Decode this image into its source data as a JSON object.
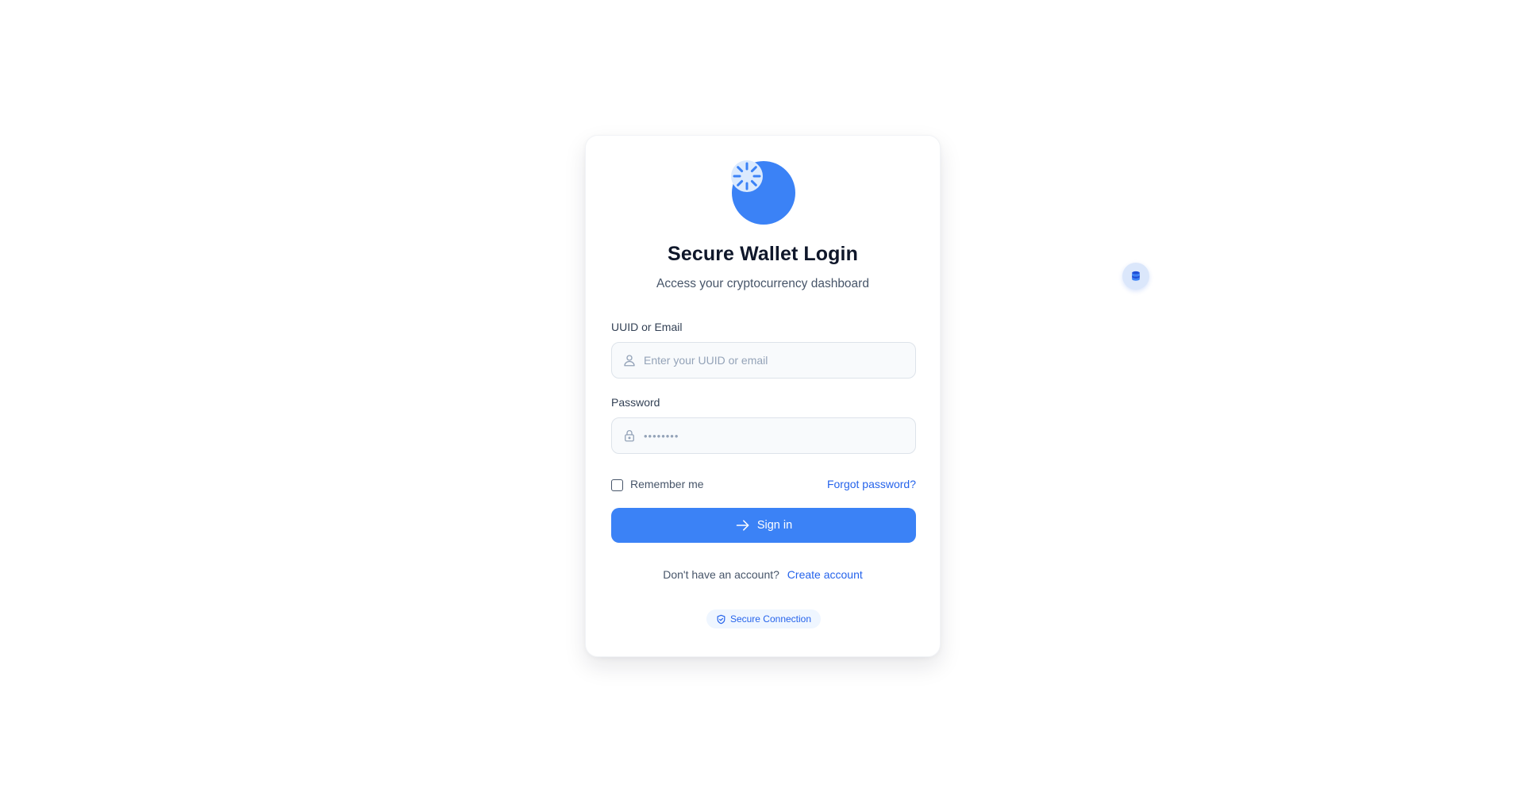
{
  "colors": {
    "accent": "#3b82f6",
    "link": "#2563eb",
    "badge_background": "#eff6ff",
    "title": "#0f172a"
  },
  "logo": {
    "icon": "spinner-icon"
  },
  "header": {
    "title": "Secure Wallet Login",
    "subtitle": "Access your cryptocurrency dashboard"
  },
  "form": {
    "identifier": {
      "label": "UUID or Email",
      "placeholder": "Enter your UUID or email",
      "value": "",
      "icon": "user-icon"
    },
    "password": {
      "label": "Password",
      "placeholder": "••••••••",
      "value": "",
      "icon": "lock-icon"
    },
    "remember_label": "Remember me",
    "remember_checked": false,
    "forgot_label": "Forgot password?",
    "submit_label": "Sign in",
    "submit_icon": "arrow-right-icon"
  },
  "signup": {
    "prompt": "Don't have an account?",
    "link_label": "Create account"
  },
  "badge": {
    "label": "Secure Connection",
    "icon": "shield-check-icon"
  },
  "floating_button": {
    "icon": "coins-icon"
  }
}
